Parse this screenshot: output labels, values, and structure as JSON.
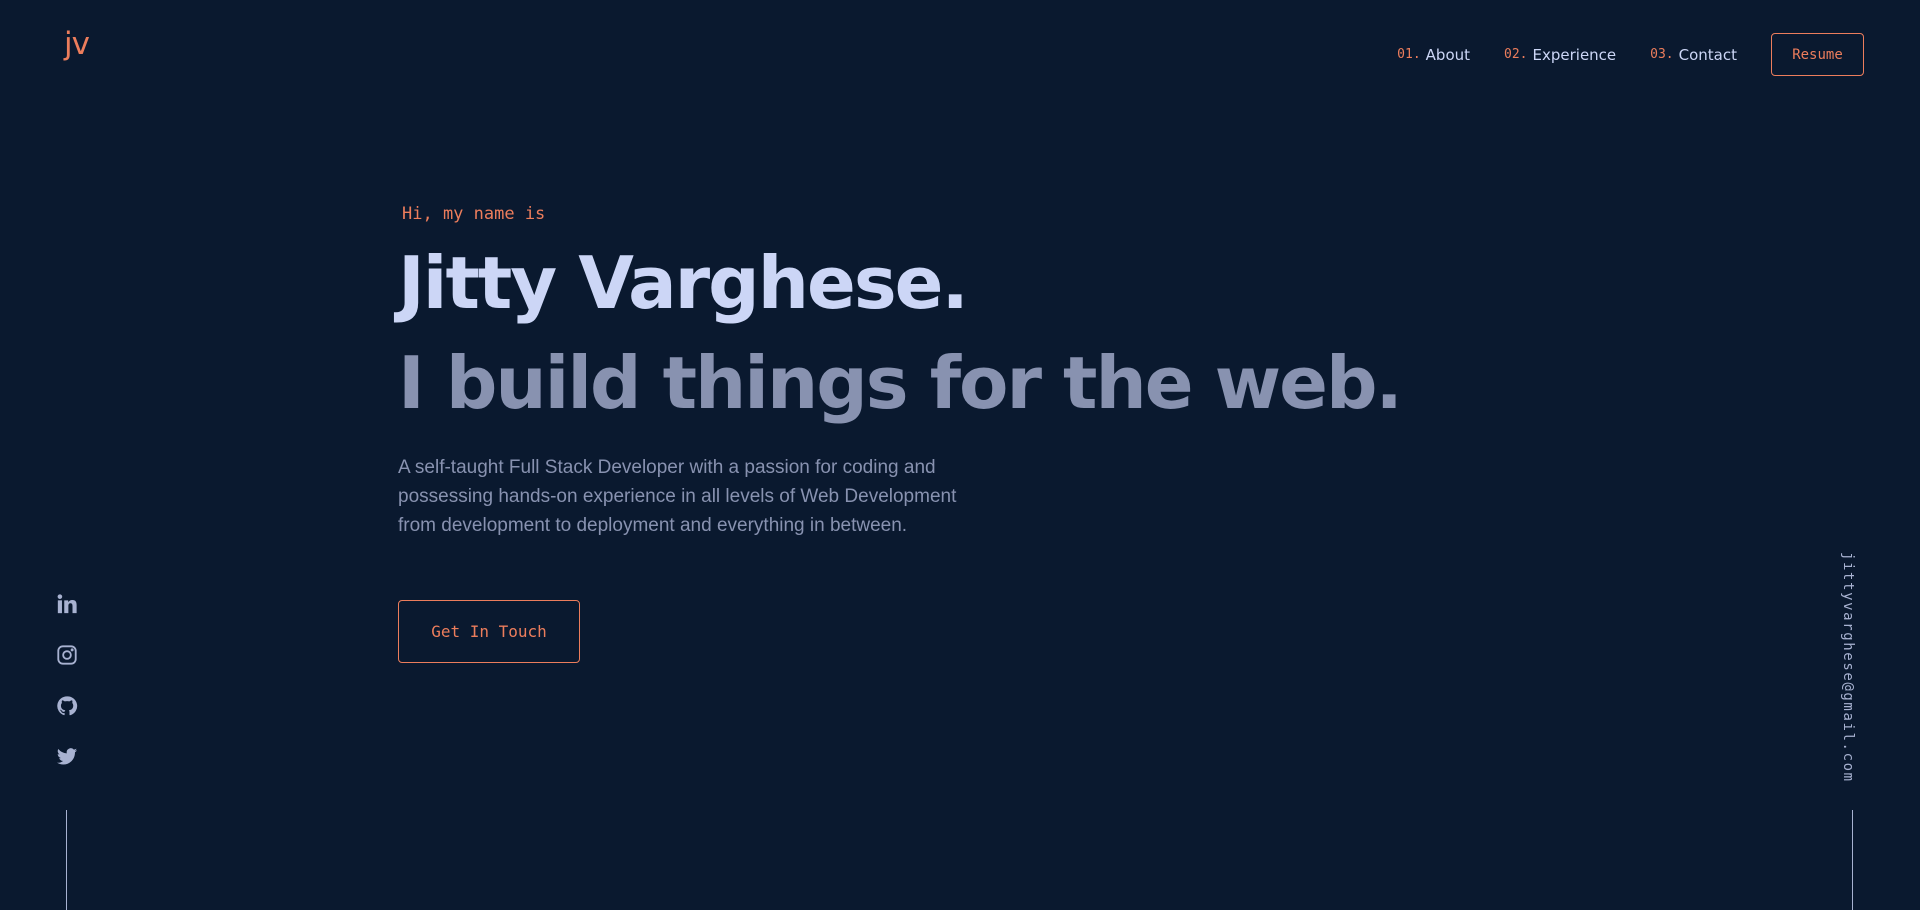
{
  "header": {
    "logo": "jv",
    "nav": [
      {
        "number": "01.",
        "label": "About"
      },
      {
        "number": "02.",
        "label": "Experience"
      },
      {
        "number": "03.",
        "label": "Contact"
      }
    ],
    "resume_label": "Resume"
  },
  "hero": {
    "intro": "Hi, my name is",
    "name": "Jitty Varghese.",
    "tagline": "I build things for the web.",
    "description": "A self-taught Full Stack Developer with a passion for coding and possessing hands-on experience in all levels of Web Development from development to deployment and everything in between.",
    "cta_label": "Get In Touch"
  },
  "social": {
    "icons": [
      "linkedin-icon",
      "instagram-icon",
      "github-icon",
      "twitter-icon"
    ]
  },
  "email": "jittyvarghese@gmail.com",
  "colors": {
    "background": "#0a192f",
    "accent": "#ec7d5c",
    "heading": "#ccd6f6",
    "text": "#8892b0",
    "light_text": "#a8b2d1"
  }
}
